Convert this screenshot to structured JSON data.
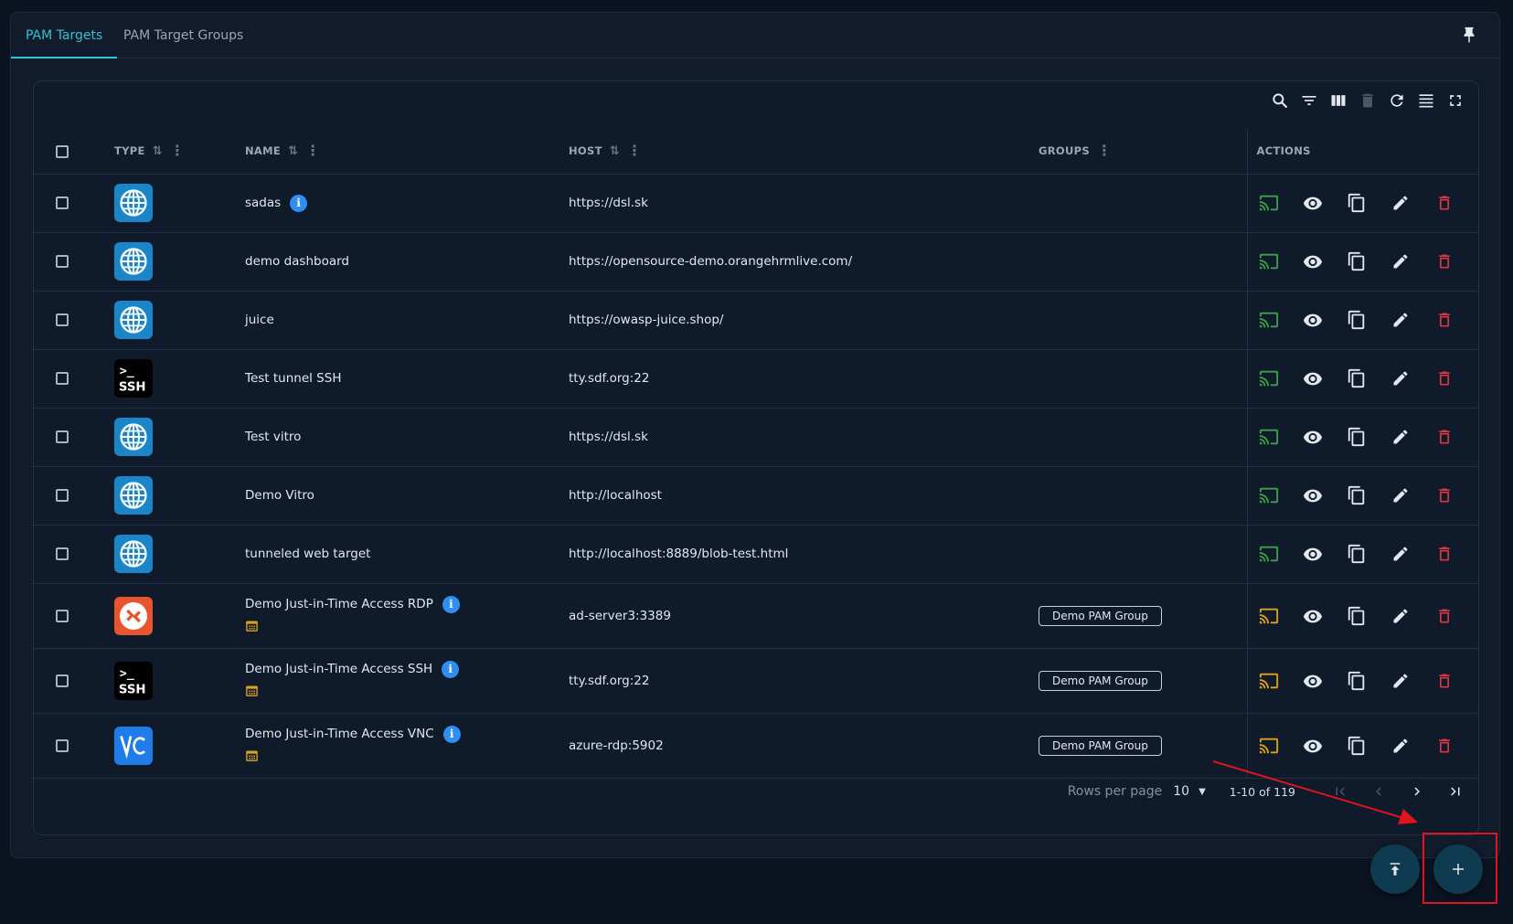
{
  "tabs": [
    {
      "label": "PAM Targets",
      "active": true
    },
    {
      "label": "PAM Target Groups",
      "active": false
    }
  ],
  "toolbar_icons": [
    "search-icon",
    "filter-icon",
    "columns-icon",
    "delete-icon",
    "refresh-icon",
    "density-icon",
    "fullscreen-icon"
  ],
  "table": {
    "headers": {
      "type": "TYPE",
      "name": "NAME",
      "host": "HOST",
      "groups": "GROUPS",
      "actions": "ACTIONS"
    },
    "rows": [
      {
        "type": "web",
        "name": "sadas",
        "info": true,
        "schedule": false,
        "host": "https://dsl.sk",
        "group": "",
        "connect_color": "#3aa14a"
      },
      {
        "type": "web",
        "name": "demo dashboard",
        "info": false,
        "schedule": false,
        "host": "https://opensource-demo.orangehrmlive.com/",
        "group": "",
        "connect_color": "#3aa14a"
      },
      {
        "type": "web",
        "name": "juice",
        "info": false,
        "schedule": false,
        "host": "https://owasp-juice.shop/",
        "group": "",
        "connect_color": "#3aa14a"
      },
      {
        "type": "ssh",
        "name": "Test tunnel SSH",
        "info": false,
        "schedule": false,
        "host": "tty.sdf.org:22",
        "group": "",
        "connect_color": "#3aa14a"
      },
      {
        "type": "web",
        "name": "Test vitro",
        "info": false,
        "schedule": false,
        "host": "https://dsl.sk",
        "group": "",
        "connect_color": "#3aa14a"
      },
      {
        "type": "web",
        "name": "Demo Vitro",
        "info": false,
        "schedule": false,
        "host": "http://localhost",
        "group": "",
        "connect_color": "#3aa14a"
      },
      {
        "type": "web",
        "name": "tunneled web target",
        "info": false,
        "schedule": false,
        "host": "http://localhost:8889/blob-test.html",
        "group": "",
        "connect_color": "#3aa14a"
      },
      {
        "type": "rdp",
        "name": "Demo Just-in-Time Access RDP",
        "info": true,
        "schedule": true,
        "host": "ad-server3:3389",
        "group": "Demo PAM Group",
        "connect_color": "#e0a21a"
      },
      {
        "type": "ssh",
        "name": "Demo Just-in-Time Access SSH",
        "info": true,
        "schedule": true,
        "host": "tty.sdf.org:22",
        "group": "Demo PAM Group",
        "connect_color": "#e0a21a"
      },
      {
        "type": "vnc",
        "name": "Demo Just-in-Time Access VNC",
        "info": true,
        "schedule": true,
        "host": "azure-rdp:5902",
        "group": "Demo PAM Group",
        "connect_color": "#e0a21a"
      }
    ]
  },
  "pagination": {
    "rows_per_page_label": "Rows per page",
    "rows_per_page_value": "10",
    "range": "1-10 of 119"
  },
  "colors": {
    "accent": "#2ec4d6",
    "danger": "#e0353f",
    "annotation": "#e0141e"
  }
}
